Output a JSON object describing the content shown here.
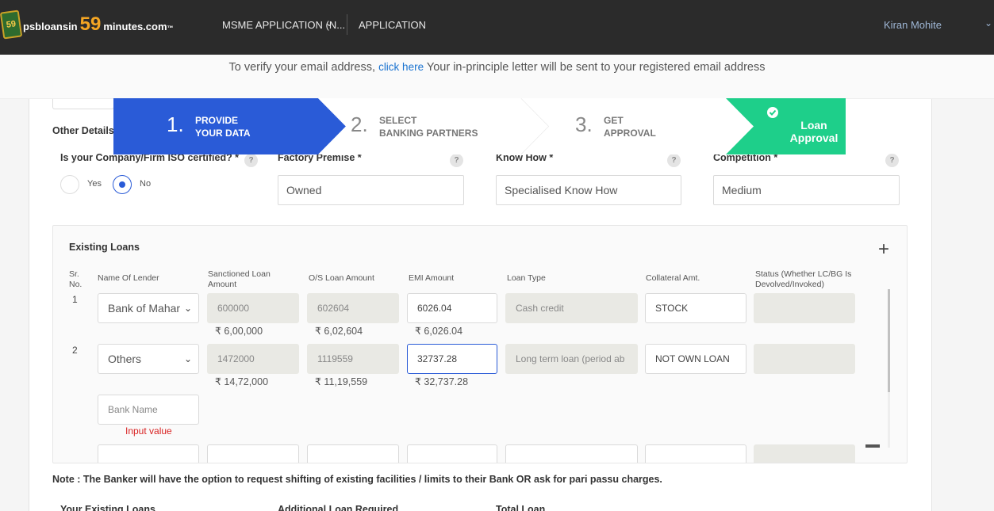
{
  "header": {
    "logo": {
      "badge": "59",
      "pre": "psbloansin",
      "num": "59",
      "post": "minutes.com",
      "tm": "™"
    },
    "nav": [
      "MSME APPLICATION (N...",
      "APPLICATION"
    ],
    "nav_chevron": "chevron-down-icon",
    "user_name": "Kiran Mohite"
  },
  "verify": {
    "prefix": "To verify your email address,",
    "link": "click here",
    "suffix": "Your in-principle letter will be sent to your registered email address"
  },
  "stepper": {
    "steps": [
      {
        "num": "1.",
        "line1": "PROVIDE",
        "line2": "YOUR DATA"
      },
      {
        "num": "2.",
        "line1": "SELECT",
        "line2": "BANKING PARTNERS"
      },
      {
        "num": "3.",
        "line1": "GET",
        "line2": "APPROVAL"
      }
    ],
    "final": {
      "line1": "Loan",
      "line2": "Approval"
    },
    "colors": {
      "active": "#2a5bd7",
      "final": "#1ecf8a"
    }
  },
  "other_details": {
    "title": "Other Details",
    "iso": {
      "label": "Is your Company/Firm ISO certified? *",
      "options": [
        "Yes",
        "No"
      ],
      "selected": "No"
    },
    "factory": {
      "label": "Factory Premise *",
      "value": "Owned"
    },
    "know_how": {
      "label": "Know How *",
      "value": "Specialised Know How"
    },
    "competition": {
      "label": "Competition *",
      "value": "Medium"
    },
    "help": "?"
  },
  "existing_loans": {
    "title": "Existing Loans",
    "add_icon": "+",
    "columns": [
      "Sr. No.",
      "Name Of Lender",
      "Sanctioned Loan Amount",
      "O/S Loan Amount",
      "EMI Amount",
      "Loan Type",
      "Collateral Amt.",
      "Status (Whether LC/BG Is Devolved/Invoked)"
    ],
    "rows": [
      {
        "sr": "1",
        "lender": "Bank of Mahar",
        "sanctioned": "600000",
        "sanctioned_fmt": "₹ 6,00,000",
        "outstanding": "602604",
        "outstanding_fmt": "₹ 6,02,604",
        "emi": "6026.04",
        "emi_fmt": "₹ 6,026.04",
        "loan_type": "Cash credit",
        "collateral": "STOCK",
        "status": ""
      },
      {
        "sr": "2",
        "lender": "Others",
        "sanctioned": "1472000",
        "sanctioned_fmt": "₹ 14,72,000",
        "outstanding": "1119559",
        "outstanding_fmt": "₹ 11,19,559",
        "emi": "32737.28",
        "emi_fmt": "₹ 32,737.28",
        "loan_type": "Long term loan (period ab",
        "collateral": "NOT OWN LOAN",
        "status": ""
      }
    ],
    "bank_name_placeholder": "Bank Name",
    "bank_name_error": "Input value"
  },
  "note": "Note : The Banker will have the option to request shifting of existing facilities / limits to their Bank OR ask for pari passu charges.",
  "bottom_labels": [
    "Your Existing Loans",
    "Additional Loan Required",
    "Total Loan"
  ]
}
